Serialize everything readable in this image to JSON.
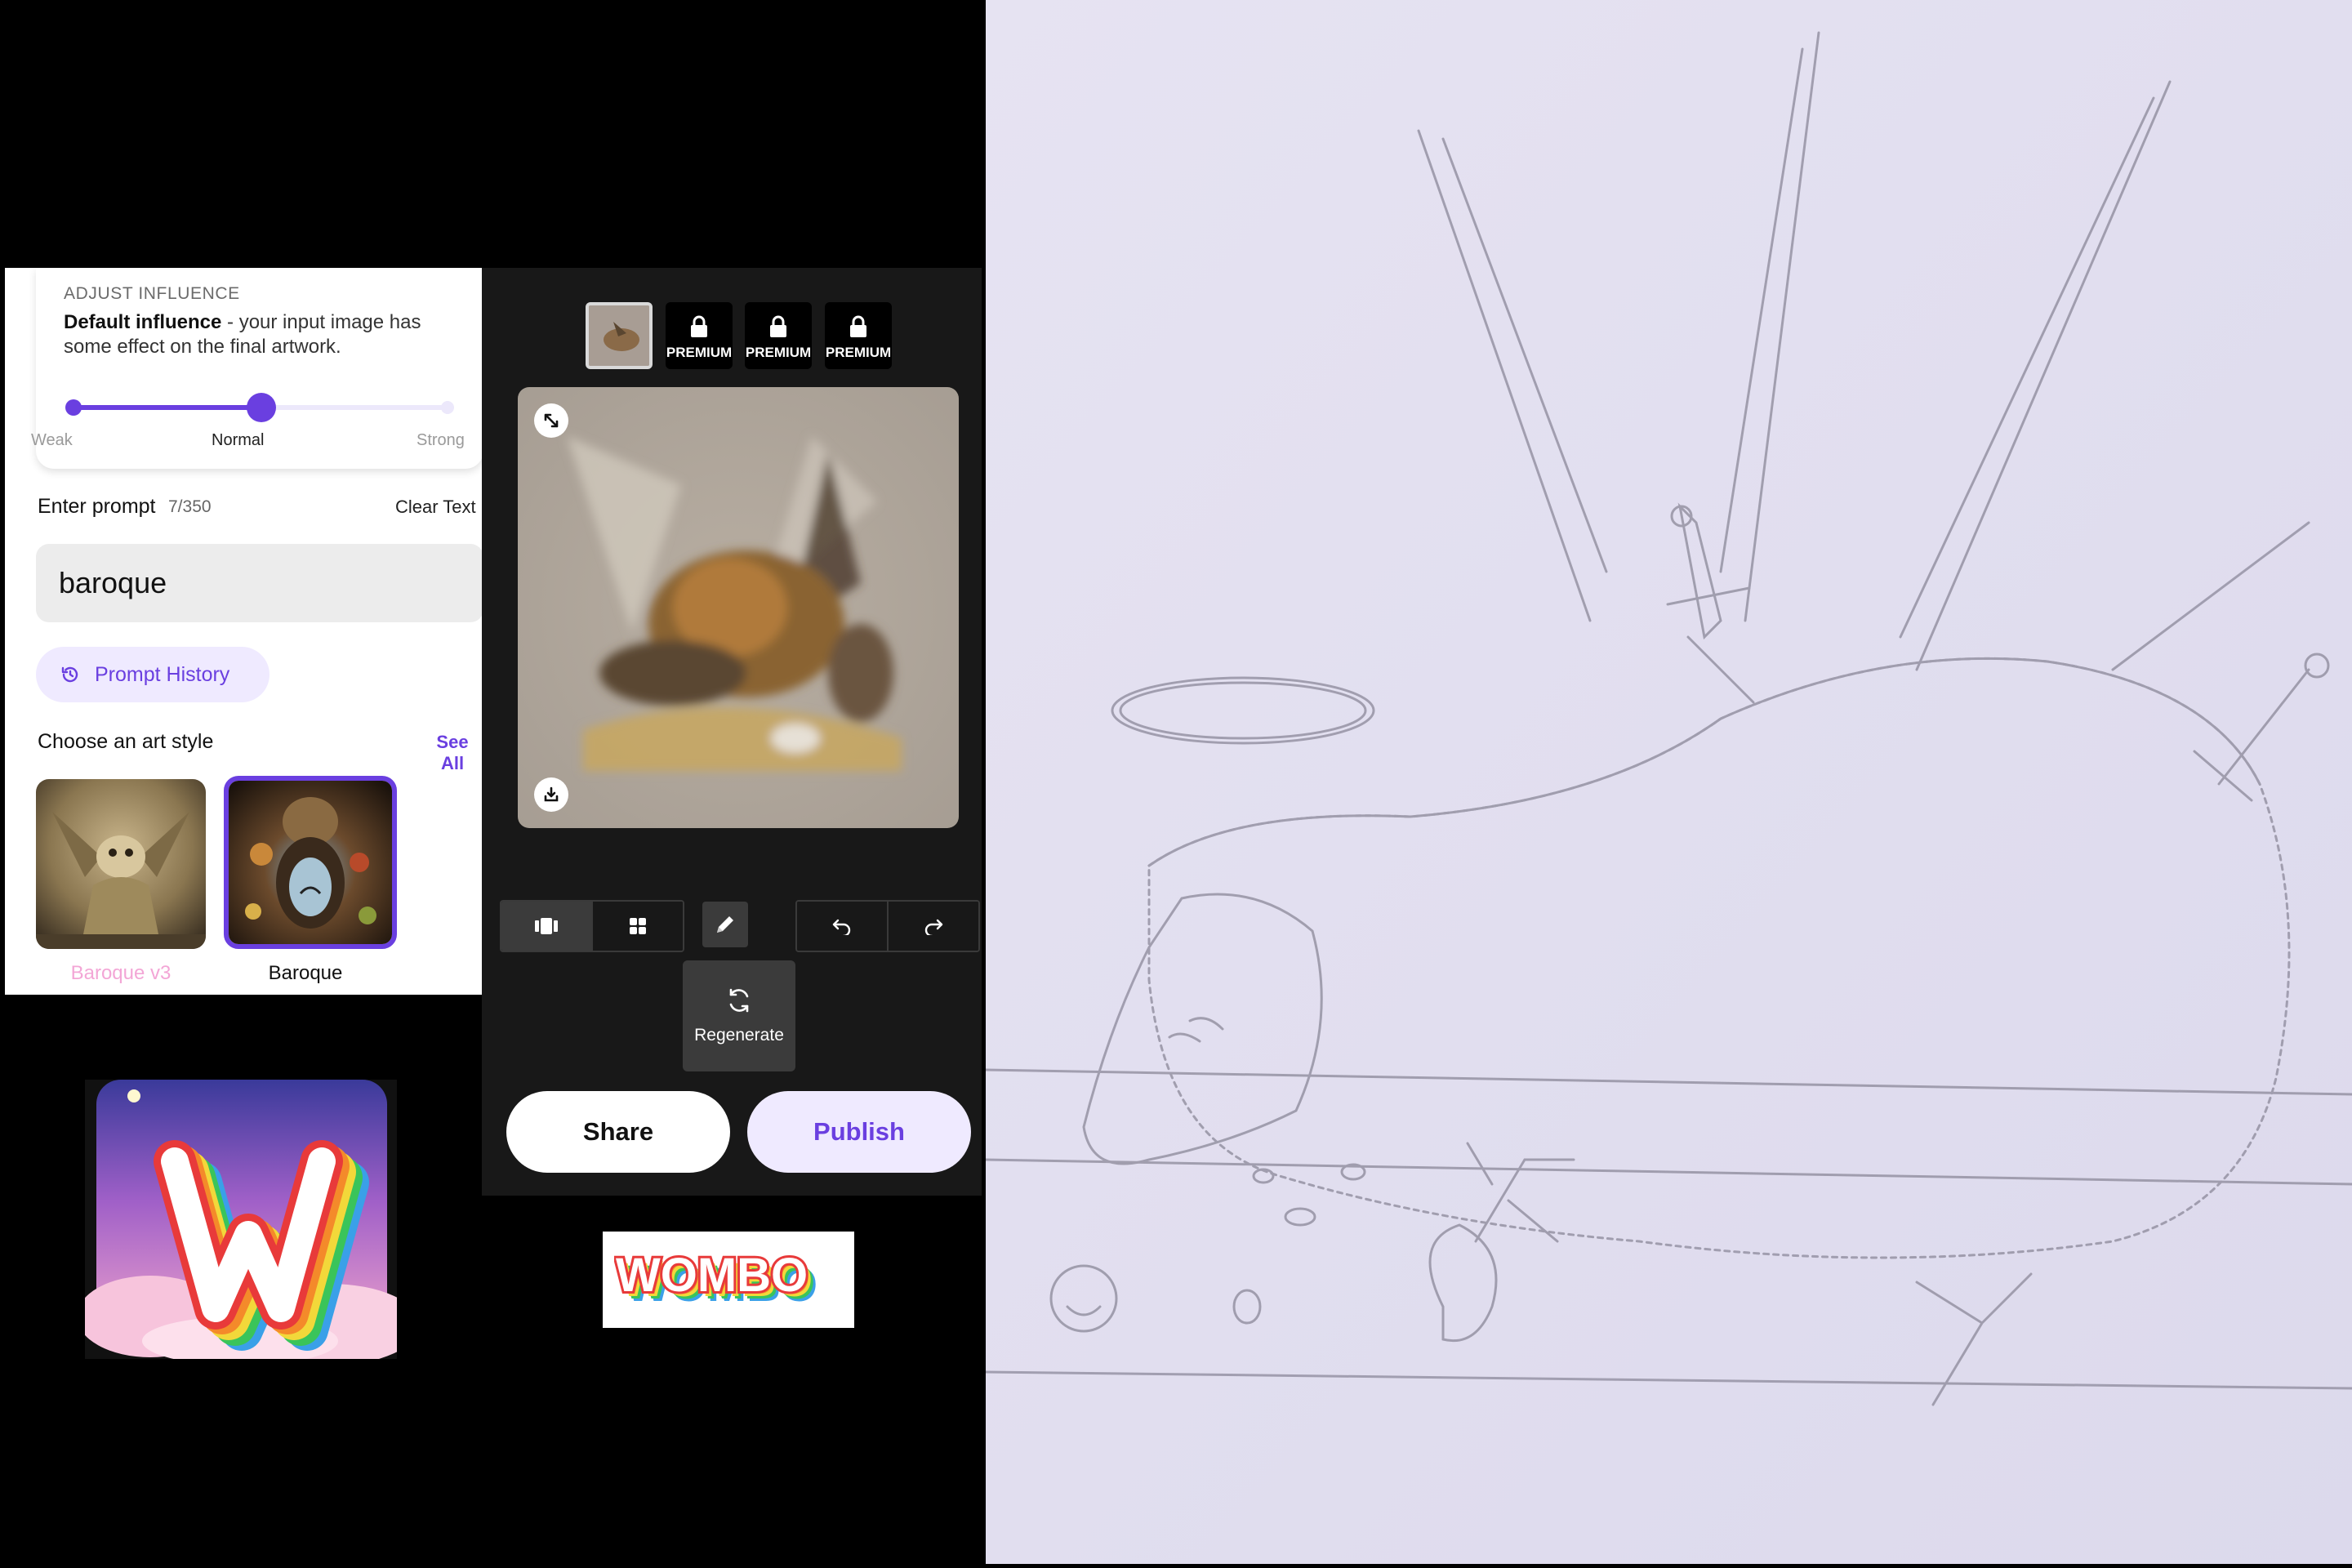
{
  "influence": {
    "heading": "ADJUST INFLUENCE",
    "mode_bold": "Default influence",
    "mode_rest": " - your input image has some effect on the final artwork.",
    "level": 0.5,
    "ticks": [
      "Weak",
      "Normal",
      "Strong"
    ],
    "selected_tick": "Normal"
  },
  "prompt": {
    "label": "Enter prompt",
    "count": "7/350",
    "clear_label": "Clear Text",
    "value": "baroque",
    "history_label": "Prompt History"
  },
  "art_style": {
    "heading": "Choose an art style",
    "see_all": "See All",
    "styles": [
      {
        "name": "Baroque v3",
        "selected": false
      },
      {
        "name": "Baroque",
        "selected": true
      }
    ]
  },
  "editor": {
    "variants": [
      {
        "locked": false,
        "label": ""
      },
      {
        "locked": true,
        "label": "PREMIUM"
      },
      {
        "locked": true,
        "label": "PREMIUM"
      },
      {
        "locked": true,
        "label": "PREMIUM"
      }
    ],
    "regenerate_label": "Regenerate",
    "share_label": "Share",
    "publish_label": "Publish"
  },
  "colors": {
    "accent": "#6a3fe0",
    "accent_soft": "#efeaff",
    "dark_panel": "#181818",
    "v3_label": "#f3a6d6"
  },
  "icons": [
    "history-icon",
    "lock-icon",
    "expand-icon",
    "download-icon",
    "single-view-icon",
    "grid-view-icon",
    "pencil-icon",
    "undo-icon",
    "redo-icon",
    "refresh-icon"
  ]
}
